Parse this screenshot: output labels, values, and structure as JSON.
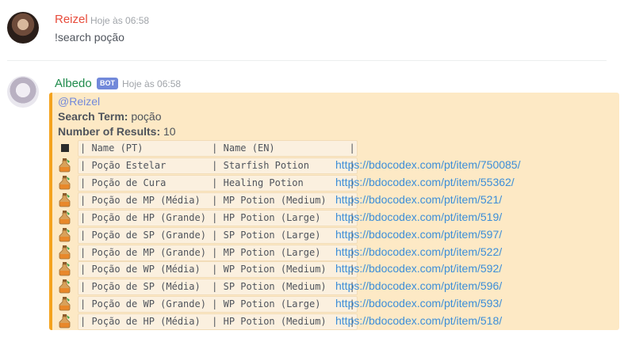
{
  "messages": [
    {
      "author": "Reizel",
      "timestamp": "Hoje às 06:58",
      "content": "!search poção"
    },
    {
      "author": "Albedo",
      "bot_tag": "BOT",
      "timestamp": "Hoje às 06:58",
      "embed": {
        "accent_color": "#f4a31e",
        "mention": "@Reizel",
        "search_term_label": "Search Term:",
        "search_term_value": " poção",
        "num_results_label": "Number of Results:",
        "num_results_value": " 10",
        "table_header": "| Name (PT)            | Name (EN)             |",
        "rows": [
          {
            "cell": "| Poção Estelar        | Starfish Potion       |",
            "link": "https://bdocodex.com/pt/item/750085/"
          },
          {
            "cell": "| Poção de Cura        | Healing Potion        |",
            "link": "https://bdocodex.com/pt/item/55362/"
          },
          {
            "cell": "| Poção de MP (Média)  | MP Potion (Medium)    |",
            "link": "https://bdocodex.com/pt/item/521/"
          },
          {
            "cell": "| Poção de HP (Grande) | HP Potion (Large)     |",
            "link": "https://bdocodex.com/pt/item/519/"
          },
          {
            "cell": "| Poção de SP (Grande) | SP Potion (Large)     |",
            "link": "https://bdocodex.com/pt/item/597/"
          },
          {
            "cell": "| Poção de MP (Grande) | MP Potion (Large)     |",
            "link": "https://bdocodex.com/pt/item/522/"
          },
          {
            "cell": "| Poção de WP (Média)  | WP Potion (Medium)    |",
            "link": "https://bdocodex.com/pt/item/592/"
          },
          {
            "cell": "| Poção de SP (Média)  | SP Potion (Medium)    |",
            "link": "https://bdocodex.com/pt/item/596/"
          },
          {
            "cell": "| Poção de WP (Grande) | WP Potion (Large)     |",
            "link": "https://bdocodex.com/pt/item/593/"
          },
          {
            "cell": "| Poção de HP (Média)  | HP Potion (Medium)    |",
            "link": "https://bdocodex.com/pt/item/518/"
          }
        ],
        "row_icon": "potion-icon",
        "header_icon": "black-square-icon"
      }
    }
  ]
}
